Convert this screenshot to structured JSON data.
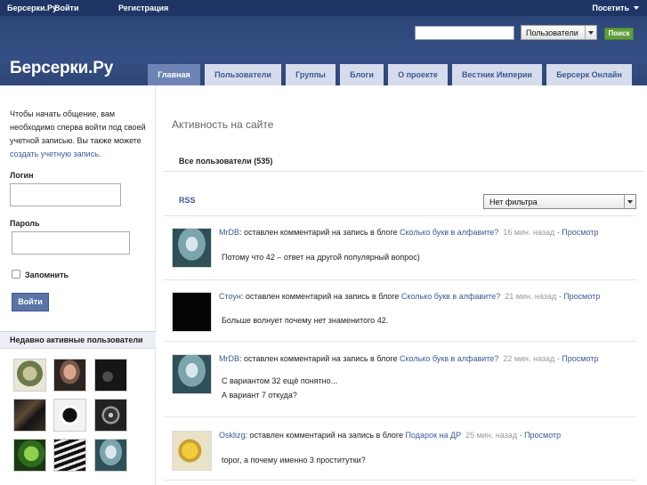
{
  "topbar": {
    "site": "Берсерки.Ру",
    "login": "Войти",
    "register": "Регистрация",
    "visit": "Посетить"
  },
  "header": {
    "logo": "Берсерки.Ру",
    "search_value": "",
    "search_scope": "Пользователи",
    "search_button": "Поиск"
  },
  "tabs": [
    {
      "label": "Главная",
      "active": true
    },
    {
      "label": "Пользователи"
    },
    {
      "label": "Группы"
    },
    {
      "label": "Блоги"
    },
    {
      "label": "О проекте"
    },
    {
      "label": "Вестник Империи"
    },
    {
      "label": "Берсерк Онлайн"
    }
  ],
  "sidebar": {
    "intro": "Чтобы начать общение, вам необходимо сперва войти под своей учетной записью. Вы также можете",
    "create_link": "создать учетную запись",
    "intro_end": ".",
    "login_label": "Логин",
    "password_label": "Пароль",
    "remember": "Запомнить",
    "login_button": "Войти",
    "recent_title": "Недавно активные пользователи"
  },
  "main": {
    "title": "Активность на сайте",
    "all_users": "Все пользователи (535)",
    "rss": "RSS",
    "filter": "Нет фильтра",
    "activities": [
      {
        "user": "MrDB",
        "action": ": оставлен комментарий на запись в блоге",
        "target": "Сколько букв в алфавите?",
        "time": "16 мин. назад",
        "sep": " · ",
        "view": "Просмотр",
        "lines": [
          "Потому что 42 – ответ на другой популярный вопрос)"
        ]
      },
      {
        "user": "Стоун",
        "action": ": оставлен комментарий на запись в блоге",
        "target": "Сколько букв в алфавите?",
        "time": "21 мин. назад",
        "sep": " · ",
        "view": "Просмотр",
        "lines": [
          "Больше волнует почему нет знаменитого 42."
        ]
      },
      {
        "user": "MrDB",
        "action": ": оставлен комментарий на запись в блоге",
        "target": "Сколько букв в алфавите?",
        "time": "22 мин. назад",
        "sep": " · ",
        "view": "Просмотр",
        "lines": [
          "С вариантом 32 ещё понятно...",
          "А вариант 7 откуда?"
        ]
      },
      {
        "user": "Osklizg",
        "action": ": оставлен комментарий на запись в блоге",
        "target": "Подарок на ДР",
        "time": "25 мин. назад",
        "sep": " · ",
        "view": "Просмотр",
        "lines": [
          "topor, а почему именно 3 проститутки?"
        ]
      }
    ]
  },
  "colors": {
    "topbar": "#1f3566",
    "header": "#354f84",
    "tab": "#d6dceb",
    "tab_active": "#6d84b4",
    "link": "#3b5997",
    "search_button": "#5d9e3d"
  }
}
